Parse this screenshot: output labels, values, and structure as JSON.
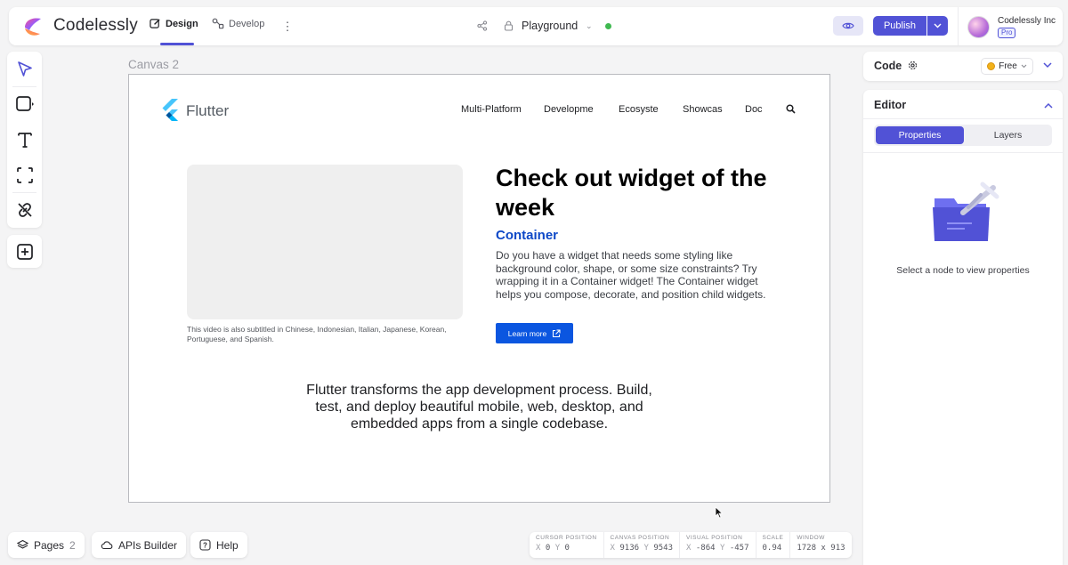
{
  "app": {
    "brand": "Codelessly",
    "tabs": [
      {
        "label": "Design",
        "active": true
      },
      {
        "label": "Develop",
        "active": false
      }
    ],
    "project_name": "Playground",
    "status_color": "#3fb950",
    "publish_label": "Publish",
    "org_name": "Codelessly Inc",
    "plan_badge": "Pro",
    "accent_color": "#5152d6"
  },
  "toolbar": {
    "tools": [
      "select-icon",
      "rectangle-icon",
      "text-icon",
      "frame-icon",
      "unlink-icon",
      "add-icon"
    ]
  },
  "canvas": {
    "label": "Canvas 2",
    "site": {
      "logo_text": "Flutter",
      "nav": [
        "Multi-Platform",
        "Developme",
        "Ecosyste",
        "Showcas",
        "Doc"
      ],
      "caption": "This video is also subtitled in Chinese, Indonesian, Italian, Japanese, Korean, Portuguese, and Spanish.",
      "hero_title": "Check out widget of the week",
      "sub_title": "Container",
      "body": "Do you have a widget that needs some styling like background color, shape, or some size constraints? Try wrapping it in a Container widget! The Container widget helps you compose, decorate, and position child widgets.",
      "learn_more": "Learn more",
      "tagline": "Flutter transforms the app development process. Build, test, and deploy beautiful mobile, web, desktop, and embedded apps from a single codebase."
    }
  },
  "right_panel": {
    "code_title": "Code",
    "plan": "Free",
    "editor_title": "Editor",
    "tabs": [
      {
        "label": "Properties",
        "active": true
      },
      {
        "label": "Layers",
        "active": false
      }
    ],
    "empty_state": "Select a node to view properties"
  },
  "bottom": {
    "pages_label": "Pages",
    "pages_count": "2",
    "apis_label": "APIs Builder",
    "help_label": "Help",
    "stats": [
      {
        "label": "CURSOR POSITION",
        "v1k": "X",
        "v1": "0",
        "v2k": "Y",
        "v2": "0"
      },
      {
        "label": "CANVAS POSITION",
        "v1k": "X",
        "v1": "9136",
        "v2k": "Y",
        "v2": "9543"
      },
      {
        "label": "VISUAL POSITION",
        "v1k": "X",
        "v1": "-864",
        "v2k": "Y",
        "v2": "-457"
      },
      {
        "label": "SCALE",
        "v1k": "",
        "v1": "0.94",
        "v2k": "",
        "v2": ""
      },
      {
        "label": "WINDOW",
        "v1k": "",
        "v1": "1728 x 913",
        "v2k": "",
        "v2": ""
      }
    ]
  }
}
